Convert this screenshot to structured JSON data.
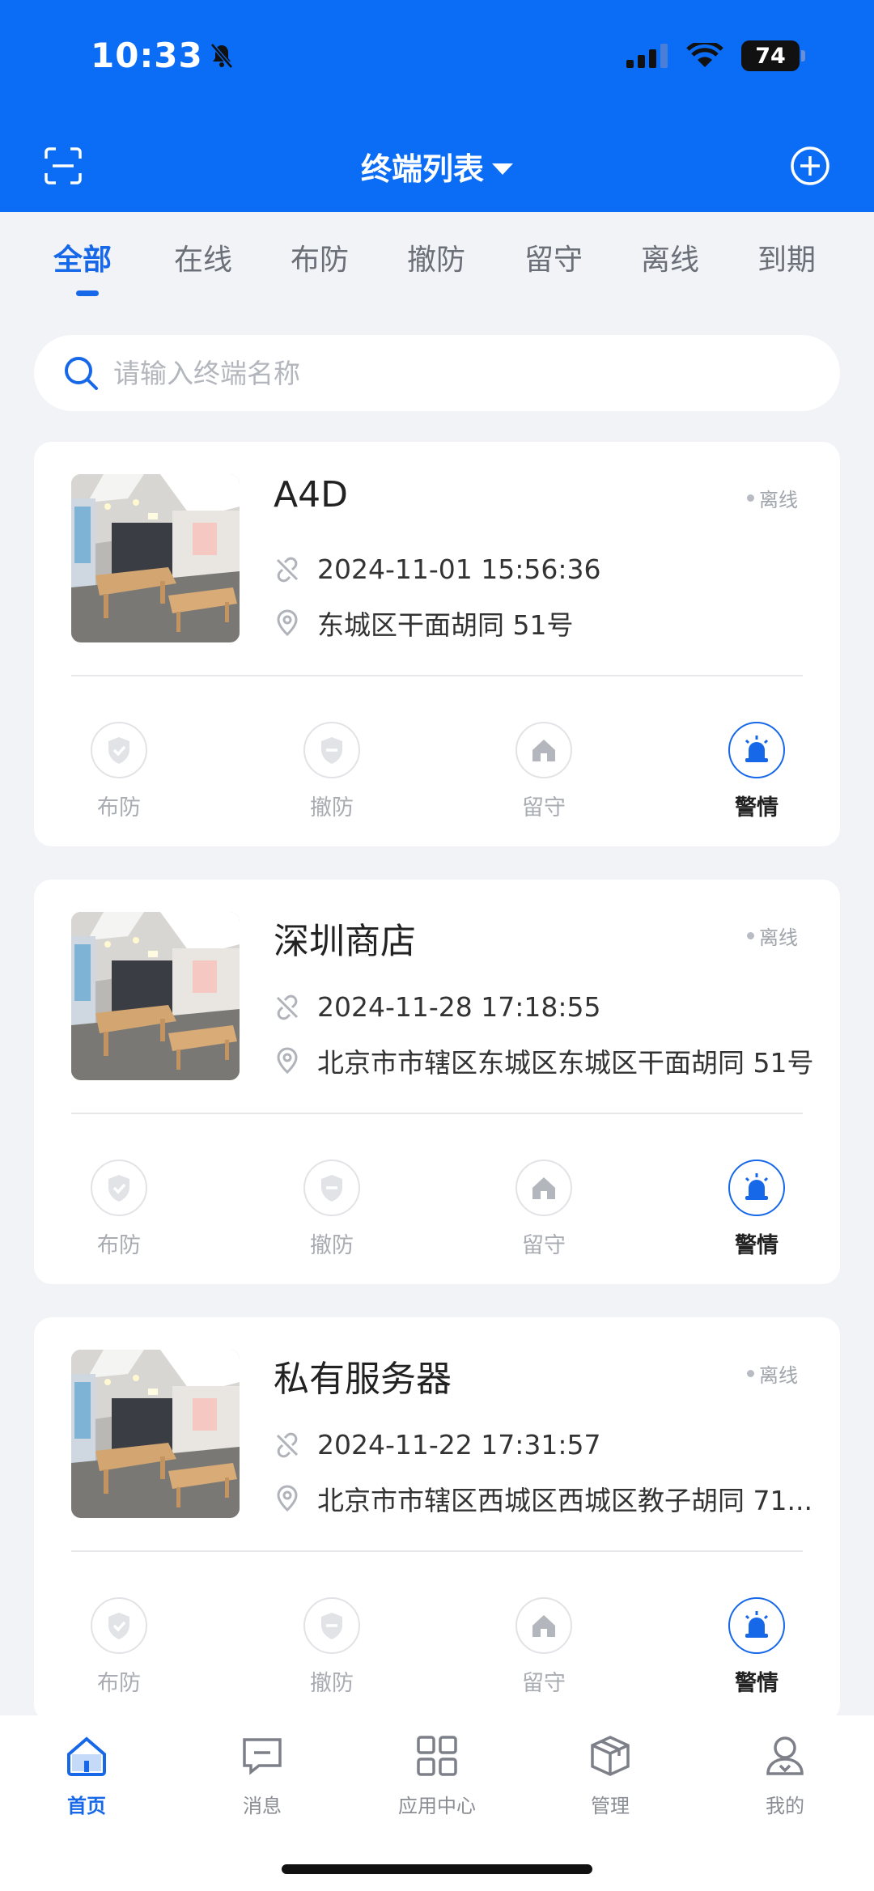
{
  "status_bar": {
    "time": "10:33",
    "battery": "74"
  },
  "header": {
    "title": "终端列表"
  },
  "tabs": [
    {
      "label": "全部",
      "active": true
    },
    {
      "label": "在线"
    },
    {
      "label": "布防"
    },
    {
      "label": "撤防"
    },
    {
      "label": "留守"
    },
    {
      "label": "离线"
    },
    {
      "label": "到期"
    }
  ],
  "search": {
    "placeholder": "请输入终端名称"
  },
  "terminals": [
    {
      "name": "A4D",
      "status": "离线",
      "time": "2024-11-01 15:56:36",
      "address": "东城区干面胡同 51号"
    },
    {
      "name": "深圳商店",
      "status": "离线",
      "time": "2024-11-28 17:18:55",
      "address": "北京市市辖区东城区东城区干面胡同 51号"
    },
    {
      "name": "私有服务器",
      "status": "离线",
      "time": "2024-11-22 17:31:57",
      "address": "北京市市辖区西城区西城区教子胡同 71..."
    }
  ],
  "actions": [
    "布防",
    "撤防",
    "留守",
    "警情"
  ],
  "bottom_nav": [
    {
      "label": "首页",
      "icon": "home-icon",
      "active": true
    },
    {
      "label": "消息",
      "icon": "message-icon"
    },
    {
      "label": "应用中心",
      "icon": "grid-icon"
    },
    {
      "label": "管理",
      "icon": "box-icon"
    },
    {
      "label": "我的",
      "icon": "person-icon"
    }
  ],
  "colors": {
    "primary": "#0b6cf5",
    "accent": "#1668e8",
    "background": "#f2f3f7"
  }
}
